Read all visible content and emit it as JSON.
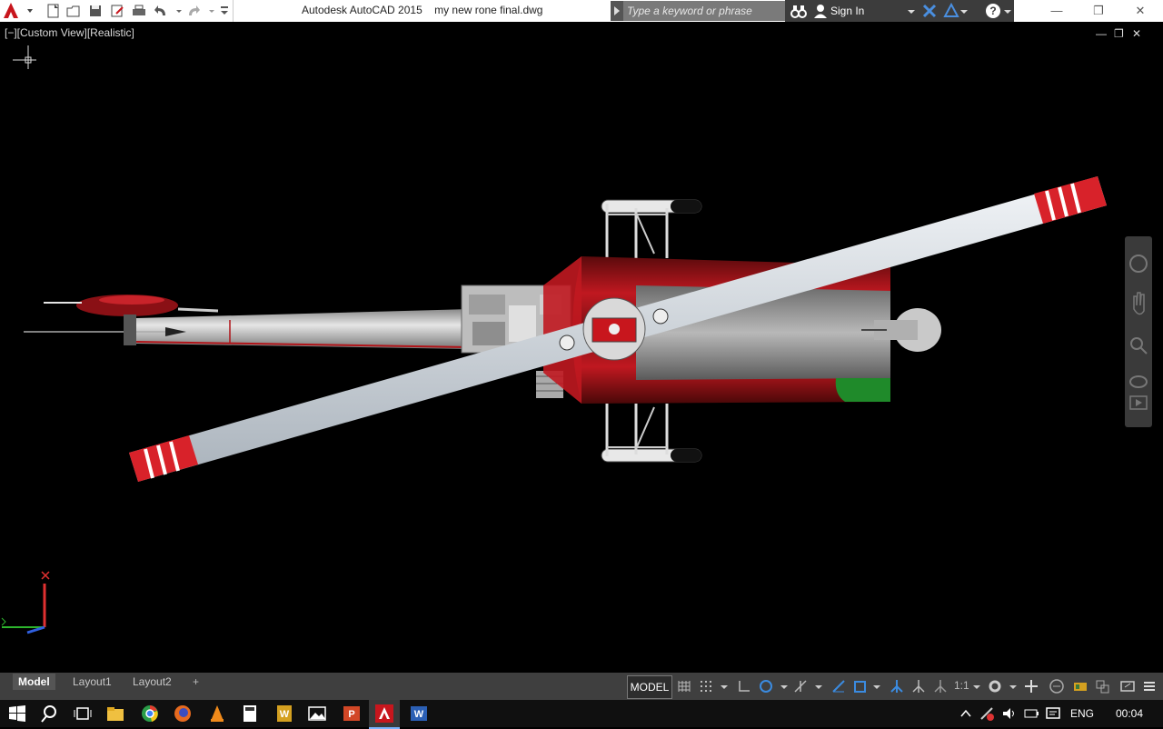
{
  "app": {
    "title": "Autodesk AutoCAD 2015    my new rone final.dwg",
    "brand_color": "#c8161d"
  },
  "search": {
    "placeholder": "Type a keyword or phrase"
  },
  "account": {
    "sign_in_label": "Sign In"
  },
  "viewport": {
    "view_label": "[−][Custom View][Realistic]"
  },
  "layout_tabs": [
    {
      "label": "Model",
      "active": true
    },
    {
      "label": "Layout1",
      "active": false
    },
    {
      "label": "Layout2",
      "active": false
    }
  ],
  "statusbar": {
    "space_label": "MODEL",
    "scale_label": "1:1"
  },
  "taskbar": {
    "language": "ENG",
    "clock": "00:04"
  }
}
